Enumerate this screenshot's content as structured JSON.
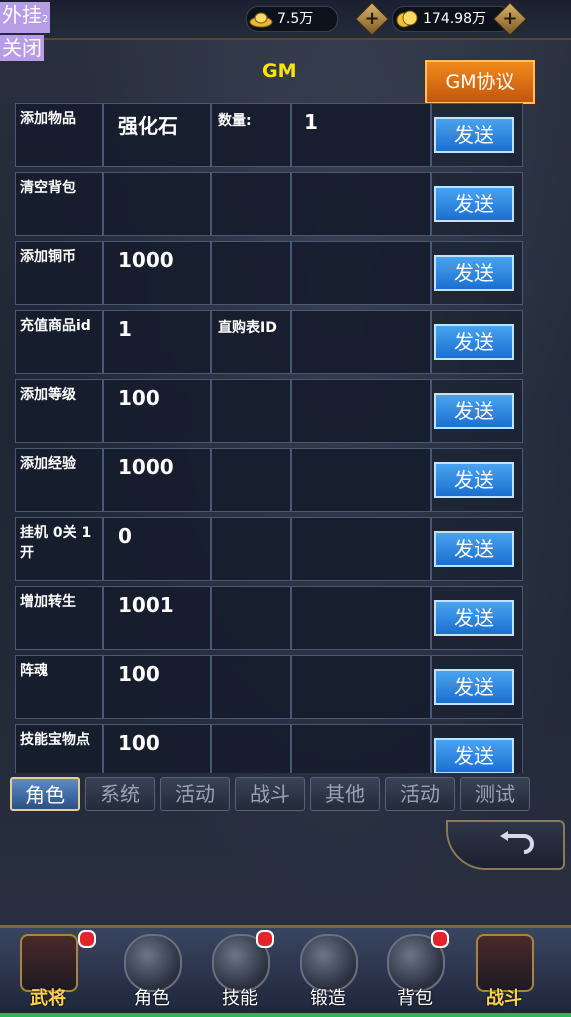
{
  "topbar": {
    "cheat_label": "外挂",
    "cheat_suffix": "2",
    "close_label": "关闭",
    "ingot_amount": "7.5万",
    "gold_amount": "174.98万",
    "plus": "+"
  },
  "gm": {
    "title": "GM",
    "protocol_button": "GM协议"
  },
  "rows": [
    {
      "label": "添加物品",
      "value": "强化石",
      "extra": "数量:",
      "value2": "1",
      "button": "发送"
    },
    {
      "label": "清空背包",
      "value": "",
      "extra": "",
      "value2": "",
      "button": "发送"
    },
    {
      "label": "添加铜币",
      "value": "1000",
      "extra": "",
      "value2": "",
      "button": "发送"
    },
    {
      "label": "充值商品id",
      "value": "1",
      "extra": "直购表ID",
      "value2": "",
      "button": "发送"
    },
    {
      "label": "添加等级",
      "value": "100",
      "extra": "",
      "value2": "",
      "button": "发送"
    },
    {
      "label": "添加经验",
      "value": "1000",
      "extra": "",
      "value2": "",
      "button": "发送"
    },
    {
      "label": "挂机 0关 1开",
      "value": "0",
      "extra": "",
      "value2": "",
      "button": "发送"
    },
    {
      "label": "增加转生",
      "value": "1001",
      "extra": "",
      "value2": "",
      "button": "发送"
    },
    {
      "label": "阵魂",
      "value": "100",
      "extra": "",
      "value2": "",
      "button": "发送"
    },
    {
      "label": "技能宝物点",
      "value": "100",
      "extra": "",
      "value2": "",
      "button": "发送"
    }
  ],
  "tabs": [
    {
      "label": "角色",
      "active": true
    },
    {
      "label": "系统",
      "active": false
    },
    {
      "label": "活动",
      "active": false
    },
    {
      "label": "战斗",
      "active": false
    },
    {
      "label": "其他",
      "active": false
    },
    {
      "label": "活动",
      "active": false
    },
    {
      "label": "测试",
      "active": false
    }
  ],
  "nav": [
    {
      "label": "武将",
      "icon": "general-icon",
      "badge": true,
      "special": true
    },
    {
      "label": "角色",
      "icon": "helmet-icon",
      "badge": false,
      "special": false
    },
    {
      "label": "技能",
      "icon": "skill-swirl-icon",
      "badge": true,
      "special": false
    },
    {
      "label": "锻造",
      "icon": "anvil-icon",
      "badge": false,
      "special": false
    },
    {
      "label": "背包",
      "icon": "bag-icon",
      "badge": true,
      "special": false
    },
    {
      "label": "战斗",
      "icon": "battle-icon",
      "badge": false,
      "special": true
    }
  ],
  "colors": {
    "accent_yellow": "#ffe600",
    "button_blue": "#1b6fd0",
    "protocol_orange": "#f08a1c",
    "badge_red": "#e3242b"
  }
}
